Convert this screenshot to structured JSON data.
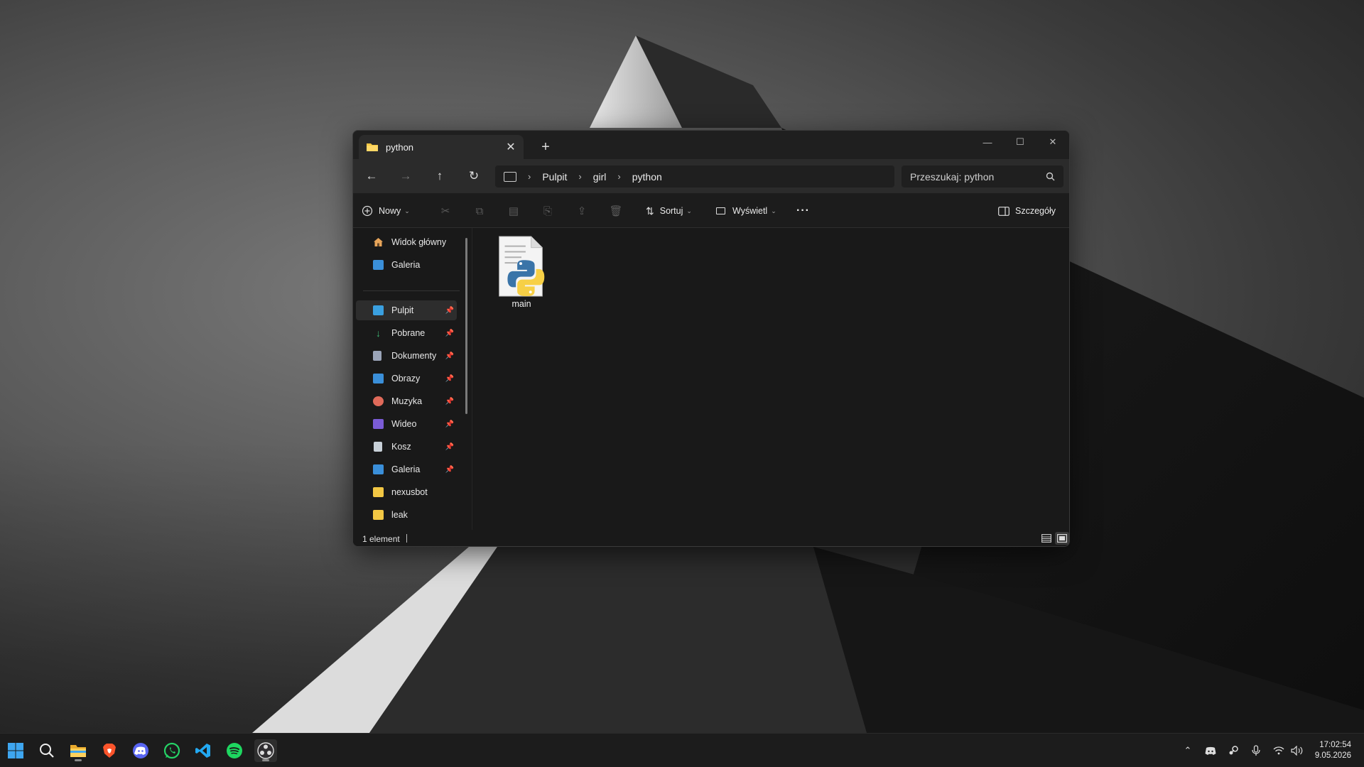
{
  "window": {
    "tab_title": "python",
    "tab_close": "✕",
    "new_tab": "+",
    "controls": {
      "minimize": "—",
      "maximize": "☐",
      "close": "✕"
    }
  },
  "navigation": {
    "back": "←",
    "forward": "→",
    "up": "↑",
    "refresh": "↻",
    "breadcrumbs": [
      "Pulpit",
      "girl",
      "python"
    ],
    "separator": "›",
    "search_placeholder": "Przeszukaj: python"
  },
  "toolbar": {
    "new_label": "Nowy",
    "sort_label": "Sortuj",
    "view_label": "Wyświetl",
    "more": "···",
    "details_label": "Szczegóły"
  },
  "sidebar": {
    "top_items": [
      {
        "label": "Widok główny",
        "icon": "home-icon"
      },
      {
        "label": "Galeria",
        "icon": "gallery-icon"
      }
    ],
    "pinned_items": [
      {
        "label": "Pulpit",
        "icon": "desktop-folder-icon",
        "color": "#3aa0e0"
      },
      {
        "label": "Pobrane",
        "icon": "download-icon",
        "color": "#3cb371"
      },
      {
        "label": "Dokumenty",
        "icon": "documents-icon",
        "color": "#9aa4b8"
      },
      {
        "label": "Obrazy",
        "icon": "pictures-icon",
        "color": "#3a8fd9"
      },
      {
        "label": "Muzyka",
        "icon": "music-icon",
        "color": "#e06a5a"
      },
      {
        "label": "Wideo",
        "icon": "video-icon",
        "color": "#7b5cd6"
      },
      {
        "label": "Kosz",
        "icon": "recycle-bin-icon",
        "color": "#c8d0d8"
      },
      {
        "label": "Galeria",
        "icon": "gallery-icon",
        "color": "#3a8fd9"
      }
    ],
    "folders": [
      {
        "label": "nexusbot",
        "icon": "folder-icon"
      },
      {
        "label": "leak",
        "icon": "folder-icon"
      }
    ]
  },
  "content": {
    "files": [
      {
        "name": "main",
        "icon": "python-file-icon"
      }
    ]
  },
  "status": {
    "count_text": "1 element"
  },
  "taskbar": {
    "apps": [
      "start-icon",
      "search-icon",
      "file-explorer-icon",
      "brave-icon",
      "discord-icon",
      "whatsapp-icon",
      "vscode-icon",
      "spotify-icon",
      "obs-icon"
    ],
    "clock_time": "17:02:54",
    "clock_date": "9.05.2026"
  },
  "colors": {
    "window_bg": "#191919",
    "navbar_bg": "#2b2b2b",
    "taskbar_bg": "#1c1c1c"
  }
}
